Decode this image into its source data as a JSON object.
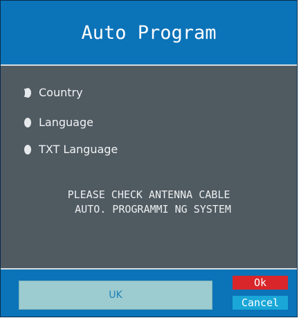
{
  "dialog": {
    "title": "Auto Program"
  },
  "menu": {
    "items": [
      {
        "label": "Country",
        "selected": true
      },
      {
        "label": "Language",
        "selected": false
      },
      {
        "label": "TXT Language",
        "selected": false
      }
    ]
  },
  "message": {
    "line1": "PLEASE CHECK ANTENNA CABLE",
    "line2": "AUTO. PROGRAMMI NG SYSTEM"
  },
  "footer": {
    "value": "UK",
    "ok_label": "Ok",
    "cancel_label": "Cancel"
  },
  "colors": {
    "title_bar": "#0b73b8",
    "body": "#4f5a61",
    "value_box": "#9ccbd0",
    "ok": "#d9262a",
    "cancel": "#1aa7d8"
  }
}
